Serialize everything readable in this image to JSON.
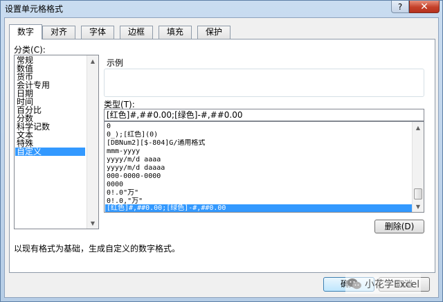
{
  "window": {
    "title": "设置单元格格式",
    "help_label": "?",
    "close_label": "✕"
  },
  "tabs": [
    {
      "label": "数字",
      "active": true
    },
    {
      "label": "对齐"
    },
    {
      "label": "字体"
    },
    {
      "label": "边框"
    },
    {
      "label": "填充"
    },
    {
      "label": "保护"
    }
  ],
  "category": {
    "label": "分类",
    "hotkey": "(C):",
    "hotkey_char": "C",
    "items": [
      "常规",
      "数值",
      "货币",
      "会计专用",
      "日期",
      "时间",
      "百分比",
      "分数",
      "科学记数",
      "文本",
      "特殊",
      "自定义"
    ],
    "selected_index": 11
  },
  "sample": {
    "label": "示例",
    "value": ""
  },
  "type_field": {
    "label": "类型",
    "hotkey": "(T):",
    "value": "[红色]#,##0.00;[绿色]-#,##0.00"
  },
  "formats": {
    "items": [
      "0",
      "0_);[红色](0)",
      "[DBNum2][$-804]G/通用格式",
      "mmm-yyyy",
      "yyyy/m/d aaaa",
      "yyyy/m/d daaaa",
      "000-0000-0000",
      "0000",
      "0!.0\"万\"",
      "0!.0,\"万\"",
      "[红色]#,##0.00;[绿色]-#,##0.00"
    ],
    "selected_index": 10
  },
  "buttons": {
    "delete": "删除(D)",
    "ok": "确定",
    "cancel": "取消"
  },
  "hint": "以现有格式为基础，生成自定义的数字格式。",
  "watermark": {
    "text": "小花学Excel",
    "icon": "wechat-icon"
  },
  "colors": {
    "selection": "#3399ff",
    "titlebar": "#c9dcf0",
    "close_button": "#c4402a"
  }
}
